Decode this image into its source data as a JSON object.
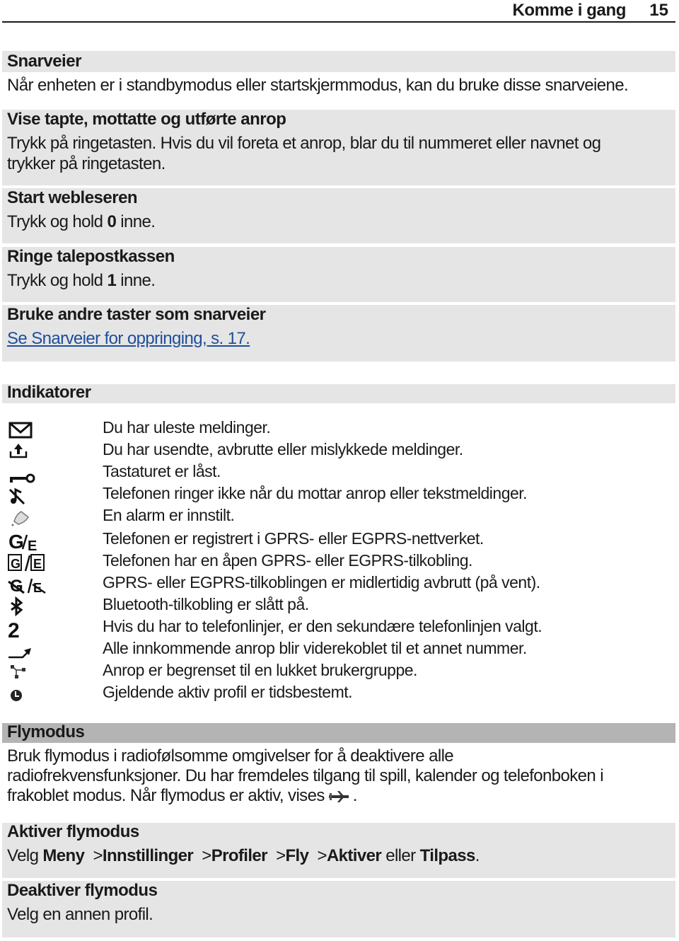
{
  "header": {
    "title": "Komme i gang",
    "page_number": "15"
  },
  "snarveier": {
    "title": "Snarveier",
    "intro": "Når enheten er i standbymodus eller startskjermmodus, kan du bruke disse snarveiene.",
    "items": [
      {
        "title": "Vise tapte, mottatte og utførte anrop",
        "line1": "Trykk på ringetasten. Hvis du vil foreta et anrop, blar du til nummeret eller navnet og",
        "line2": "trykker på ringetasten."
      },
      {
        "title": "Start webleseren",
        "pre": "Trykk og hold ",
        "key": "0",
        "post": " inne."
      },
      {
        "title": "Ringe talepostkassen",
        "pre": "Trykk og hold ",
        "key": "1",
        "post": " inne."
      },
      {
        "title": "Bruke andre taster som snarveier",
        "link": "Se Snarveier for oppringing, s. 17."
      }
    ]
  },
  "indikatorer": {
    "title": "Indikatorer",
    "items": [
      {
        "icon": "envelope-icon",
        "text": "Du har uleste meldinger."
      },
      {
        "icon": "outbox-upload-icon",
        "text": "Du har usendte, avbrutte eller mislykkede meldinger."
      },
      {
        "icon": "key-lock-icon",
        "text": "Tastaturet er låst."
      },
      {
        "icon": "silent-note-icon",
        "text": "Telefonen ringer ikke når du mottar anrop eller tekstmeldinger."
      },
      {
        "icon": "alarm-bell-icon",
        "text": "En alarm er innstilt."
      },
      {
        "icon": "gprs-egprs-registered-icon",
        "text": "Telefonen er registrert i GPRS- eller EGPRS-nettverket.",
        "glyph_a": "G",
        "glyph_b": "E"
      },
      {
        "icon": "gprs-egprs-connected-icon",
        "text": "Telefonen har en åpen GPRS- eller EGPRS-tilkobling.",
        "glyph_a": "G",
        "glyph_b": "E"
      },
      {
        "icon": "gprs-egprs-suspended-icon",
        "text": "GPRS- eller EGPRS-tilkoblingen er midlertidig avbrutt (på vent).",
        "glyph_a": "G",
        "glyph_b": "E"
      },
      {
        "icon": "bluetooth-icon",
        "text": "Bluetooth-tilkobling er slått på."
      },
      {
        "icon": "line-two-icon",
        "text": "Hvis du har to telefonlinjer, er den sekundære telefonlinjen valgt.",
        "glyph": "2"
      },
      {
        "icon": "call-divert-icon",
        "text": "Alle innkommende anrop blir viderekoblet til et annet nummer."
      },
      {
        "icon": "closed-user-group-icon",
        "text": "Anrop er begrenset til en lukket brukergruppe."
      },
      {
        "icon": "timed-profile-icon",
        "text": "Gjeldende aktiv profil er tidsbestemt."
      }
    ]
  },
  "flymodus": {
    "title": "Flymodus",
    "line1": "Bruk flymodus i radiofølsomme omgivelser for å deaktivere alle",
    "line2": "radiofrekvensfunksjoner. Du har fremdeles tilgang til spill, kalender og telefonboken i",
    "line3_pre": "frakoblet modus. Når flymodus er aktiv, vises",
    "line3_post": ".",
    "aktiver": {
      "title": "Aktiver flymodus",
      "velg": "Velg",
      "path": [
        "Meny",
        "Innstillinger",
        "Profiler",
        "Fly",
        "Aktiver"
      ],
      "separator": ">",
      "or": "eller",
      "last": "Tilpass",
      "end": "."
    },
    "deaktiver": {
      "title": "Deaktiver flymodus",
      "text": "Velg en annen profil."
    }
  }
}
